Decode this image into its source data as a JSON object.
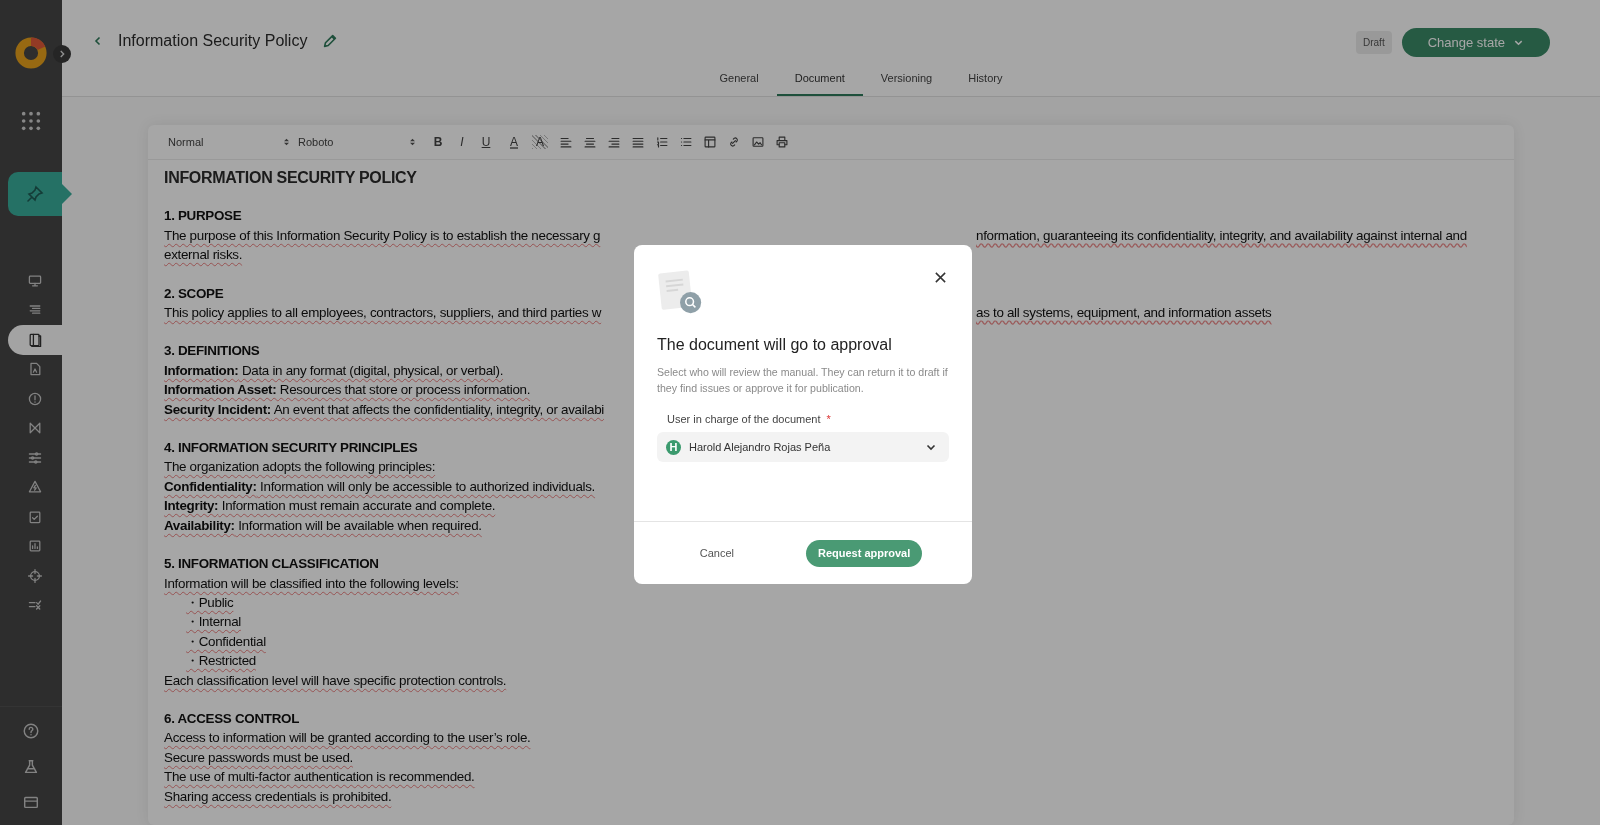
{
  "sidebar": {
    "items": [
      {
        "selected": false
      },
      {
        "selected": false
      },
      {
        "selected": true
      },
      {
        "selected": false
      },
      {
        "selected": false
      },
      {
        "selected": false
      },
      {
        "selected": false
      },
      {
        "selected": false
      },
      {
        "selected": false
      },
      {
        "selected": false
      },
      {
        "selected": false
      },
      {
        "selected": false
      }
    ],
    "bottom_items": [
      {
        "selected": false
      },
      {
        "selected": false
      },
      {
        "selected": false
      }
    ]
  },
  "header": {
    "title": "Information Security Policy",
    "status": "Draft",
    "action": "Change state"
  },
  "tabs": [
    {
      "label": "General",
      "selected": false
    },
    {
      "label": "Document",
      "selected": true
    },
    {
      "label": "Versioning",
      "selected": false
    },
    {
      "label": "History",
      "selected": false
    }
  ],
  "toolbar": {
    "style_select": "Normal",
    "font_select": "Roboto",
    "format_buttons": [
      "B",
      "I",
      "U",
      "A",
      "A"
    ]
  },
  "document": {
    "lines": [
      {
        "kind": "title",
        "text": "INFORMATION SECURITY POLICY"
      },
      {
        "kind": "heading",
        "text": "1. PURPOSE"
      },
      {
        "kind": "para",
        "text": " The purpose of this Information Security Policy is to establish the necessary g",
        "text_right": "nformation, guaranteeing its confidentiality, integrity, and availability against internal and"
      },
      {
        "kind": "para",
        "text": "external risks."
      },
      {
        "kind": "heading",
        "text": "2. SCOPE"
      },
      {
        "kind": "para",
        "text": " This policy applies to all employees, contractors, suppliers, and third parties w",
        "text_right": "as to all systems, equipment, and information assets"
      },
      {
        "kind": "heading",
        "text": "3. DEFINITIONS"
      },
      {
        "kind": "para",
        "text": " **Information:** Data in any format (digital, physical, or verbal)."
      },
      {
        "kind": "para",
        "text": " **Information Asset:** Resources that store or process information."
      },
      {
        "kind": "para",
        "text": " **Security Incident:** An event that affects the confidentiality, integrity, or availabi"
      },
      {
        "kind": "heading",
        "text": "4. INFORMATION SECURITY PRINCIPLES"
      },
      {
        "kind": "para",
        "text": " The organization adopts the following principles:"
      },
      {
        "kind": "para",
        "text": "**Confidentiality:** Information will only be accessible to authorized individuals."
      },
      {
        "kind": "para",
        "text": "**Integrity:** Information must remain accurate and complete."
      },
      {
        "kind": "para",
        "text": "**Availability:** Information will be available when required."
      },
      {
        "kind": "heading",
        "text": "5. INFORMATION CLASSIFICATION"
      },
      {
        "kind": "para",
        "text": " Information will be classified into the following levels:"
      },
      {
        "kind": "bullet",
        "text": "・Public"
      },
      {
        "kind": "bullet",
        "text": "・Internal"
      },
      {
        "kind": "bullet",
        "text": "・Confidential"
      },
      {
        "kind": "bullet",
        "text": "・Restricted"
      },
      {
        "kind": "para",
        "text": "Each classification level will have specific protection controls."
      },
      {
        "kind": "heading",
        "text": "6. ACCESS CONTROL"
      },
      {
        "kind": "para",
        "text": " Access to information will be granted according to the user’s role."
      },
      {
        "kind": "para",
        "text": " Secure passwords must be used."
      },
      {
        "kind": "para",
        "text": " The use of multi-factor authentication is recommended."
      },
      {
        "kind": "para",
        "text": " Sharing access credentials is prohibited."
      }
    ]
  },
  "dialog": {
    "title": "The document will go to approval",
    "description": "Select who will review the manual. They can return it to draft if they find issues or approve it for publication.",
    "field": {
      "label": "User in charge of the document",
      "required_mark": "*",
      "avatar": "H",
      "value": "Harold Alejandro Rojas Peña"
    },
    "buttons": [
      {
        "label": "Cancel",
        "kind": "secondary"
      },
      {
        "label": "Request approval",
        "kind": "primary"
      }
    ]
  }
}
